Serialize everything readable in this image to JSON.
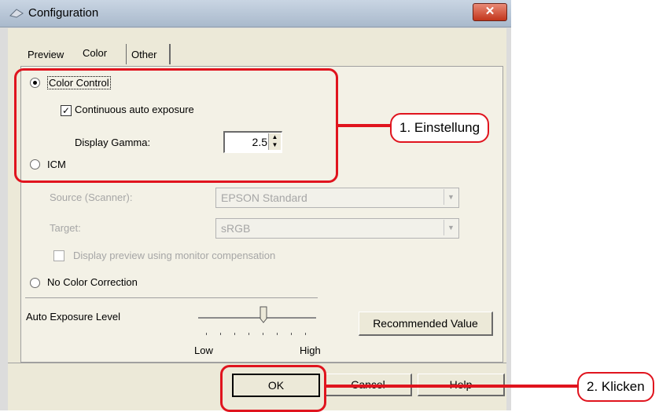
{
  "window": {
    "title": "Configuration",
    "close_glyph": "✕"
  },
  "tabs": [
    {
      "label": "Preview"
    },
    {
      "label": "Color"
    },
    {
      "label": "Other"
    }
  ],
  "color_section": {
    "color_control_label": "Color Control",
    "color_control_selected": true,
    "continuous_auto_exposure_label": "Continuous auto exposure",
    "continuous_auto_exposure_checked": true,
    "display_gamma_label": "Display Gamma:",
    "display_gamma_value": "2.5",
    "icm_label": "ICM",
    "source_label": "Source (Scanner):",
    "source_value": "EPSON Standard",
    "target_label": "Target:",
    "target_value": "sRGB",
    "display_preview_label": "Display preview using monitor compensation",
    "no_color_correction_label": "No Color Correction",
    "auto_exposure_level_label": "Auto Exposure Level",
    "slider_low_label": "Low",
    "slider_high_label": "High",
    "recommended_value_label": "Recommended Value"
  },
  "buttons": {
    "ok": "OK",
    "cancel": "Cancel",
    "help": "Help"
  },
  "callouts": {
    "step1": "1. Einstellung",
    "step2": "2. Klicken"
  },
  "colors": {
    "highlight": "#e0141e",
    "title_bar": "#b9c8d9",
    "dialog_bg": "#ece9d8"
  }
}
